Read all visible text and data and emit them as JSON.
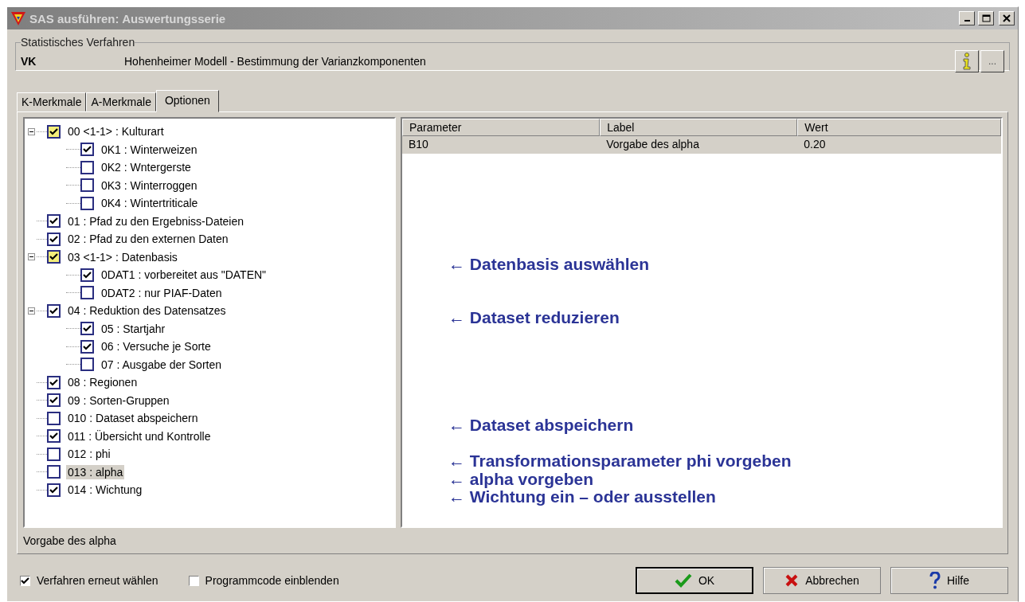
{
  "window": {
    "title": "SAS ausführen: Auswertungsserie"
  },
  "procedure": {
    "legend": "Statistisches Verfahren",
    "code": "VK",
    "description": "Hohenheimer Modell  -  Bestimmung der Varianzkomponenten",
    "more_button": "..."
  },
  "tabs": [
    {
      "label": "K-Merkmale",
      "selected": false
    },
    {
      "label": "A-Merkmale",
      "selected": false
    },
    {
      "label": "Optionen",
      "selected": true
    }
  ],
  "options_tree": [
    {
      "label": "00 <1-1> : Kulturart",
      "checked": true,
      "kind": "tristate",
      "selected": false,
      "expanded": true,
      "children": [
        {
          "label": "0K1 : Winterweizen",
          "checked": true,
          "kind": "plain",
          "selected": false
        },
        {
          "label": "0K2 : Wntergerste",
          "checked": false,
          "kind": "plain",
          "selected": false
        },
        {
          "label": "0K3 : Winterroggen",
          "checked": false,
          "kind": "plain",
          "selected": false
        },
        {
          "label": "0K4 : Wintertriticale",
          "checked": false,
          "kind": "plain",
          "selected": false
        }
      ]
    },
    {
      "label": "01 : Pfad zu den Ergebniss-Dateien",
      "checked": true,
      "kind": "plain",
      "selected": false
    },
    {
      "label": "02 : Pfad zu den externen Daten",
      "checked": true,
      "kind": "plain",
      "selected": false
    },
    {
      "label": "03 <1-1> : Datenbasis",
      "checked": true,
      "kind": "tristate",
      "selected": false,
      "expanded": true,
      "note": "← Datenbasis auswählen",
      "children": [
        {
          "label": "0DAT1 : vorbereitet aus \"DATEN\"",
          "checked": true,
          "kind": "plain",
          "selected": false
        },
        {
          "label": "0DAT2 : nur PIAF-Daten",
          "checked": false,
          "kind": "plain",
          "selected": false
        }
      ]
    },
    {
      "label": "04 : Reduktion des Datensatzes",
      "checked": true,
      "kind": "plain",
      "selected": false,
      "expanded": true,
      "note": "← Dataset reduzieren",
      "children": [
        {
          "label": "05 : Startjahr",
          "checked": true,
          "kind": "plain",
          "selected": false
        },
        {
          "label": "06 : Versuche je Sorte",
          "checked": true,
          "kind": "plain",
          "selected": false
        },
        {
          "label": "07 : Ausgabe der Sorten",
          "checked": false,
          "kind": "plain",
          "selected": false
        }
      ]
    },
    {
      "label": "08 : Regionen",
      "checked": true,
      "kind": "plain",
      "selected": false
    },
    {
      "label": "09 : Sorten-Gruppen",
      "checked": true,
      "kind": "plain",
      "selected": false
    },
    {
      "label": "010 : Dataset abspeichern",
      "checked": false,
      "kind": "plain",
      "selected": false,
      "note": "← Dataset abspeichern"
    },
    {
      "label": "011 : Übersicht und Kontrolle",
      "checked": true,
      "kind": "plain",
      "selected": false
    },
    {
      "label": "012 : phi",
      "checked": false,
      "kind": "plain",
      "selected": false,
      "note": "← Transformationsparameter phi  vorgeben"
    },
    {
      "label": "013 : alpha",
      "checked": false,
      "kind": "plain",
      "selected": true,
      "note": "← alpha vorgeben"
    },
    {
      "label": "014 : Wichtung",
      "checked": true,
      "kind": "plain",
      "selected": false,
      "note": "← Wichtung ein – oder ausstellen"
    }
  ],
  "parameter_table": {
    "columns": [
      "Parameter",
      "Label",
      "Wert"
    ],
    "rows": [
      {
        "cells": [
          "B10",
          "Vorgabe des alpha",
          "0.20"
        ],
        "selected": true
      }
    ]
  },
  "status_text": "Vorgabe des alpha",
  "footer_checks": [
    {
      "label": "Verfahren erneut wählen",
      "checked": true
    },
    {
      "label": "Programmcode einblenden",
      "checked": false
    }
  ],
  "buttons": [
    {
      "kind": "ok",
      "label": "OK"
    },
    {
      "kind": "cancel",
      "label": "Abbrechen"
    },
    {
      "kind": "help",
      "label": "Hilfe"
    }
  ]
}
